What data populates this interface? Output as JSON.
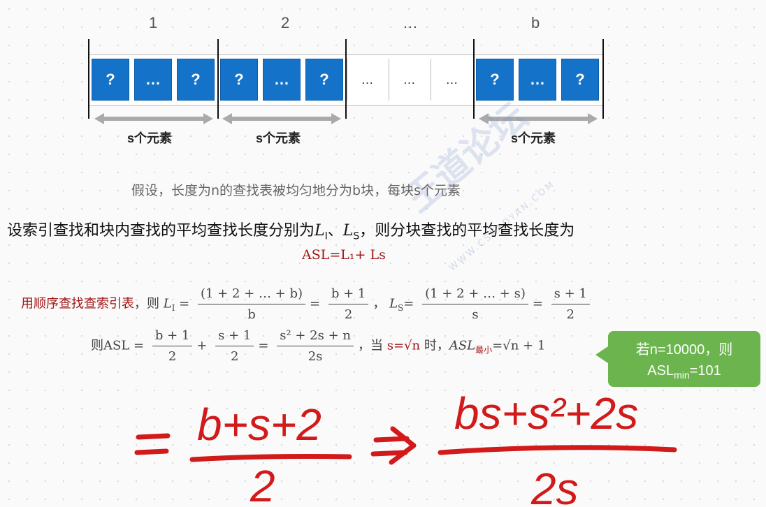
{
  "blocks": {
    "labels": [
      "1",
      "2",
      "…",
      "b"
    ],
    "cell_question": "?",
    "cell_dots": "…",
    "size_label": "s个元素"
  },
  "assumption": "假设，长度为n的查找表被均匀地分为b块，每块s个元素",
  "intro": {
    "text_before": "设索引查找和块内查找的平均查找长度分别为",
    "var_li": "L",
    "sub_i": "I",
    "sep": "、",
    "var_ls": "L",
    "sub_s": "S",
    "text_after": "，则分块查找的平均查找长度为"
  },
  "asl_formula": "ASL=L₁+ Ls",
  "formula1": {
    "prefix_plain": "用",
    "prefix_red": "顺序查找查索引表",
    "prefix_tail": "，则",
    "li_label": "L",
    "li_sub": "I",
    "eq": " =",
    "frac1_top": "(1 + 2 + … + b)",
    "frac1_bot": "b",
    "frac2_top": "b + 1",
    "frac2_bot": "2",
    "comma": "，",
    "ls_label": "L",
    "ls_sub": "S",
    "frac3_top": "(1 + 2 + … + s)",
    "frac3_bot": "s",
    "frac4_top": "s + 1",
    "frac4_bot": "2"
  },
  "formula2": {
    "prefix": "则ASL =",
    "a_top": "b + 1",
    "a_bot": "2",
    "plus": "+",
    "b_top": "s + 1",
    "b_bot": "2",
    "c_top": "s² + 2s + n",
    "c_bot": "2s",
    "when": "，当",
    "cond": "s=√n",
    "when2": "时，",
    "result_label": "ASL",
    "result_sub": "最小",
    "result_val": "=√n + 1"
  },
  "callout": {
    "line1": "若n=10000，则",
    "line2_main": "ASL",
    "line2_sub": "min",
    "line2_val": "=101"
  },
  "watermark": {
    "text": "王道论坛",
    "url": "WWW.CSKAOYAN.COM"
  },
  "handwriting": {
    "left_numerator": "b+s+2",
    "left_denominator": "2",
    "right_numerator": "bs+s²+2s",
    "right_denominator": "2s",
    "color": "#d21a1a"
  },
  "colors": {
    "cell_blue": "#1473c8",
    "accent_red": "#a31515",
    "callout_green": "#6bb44e"
  }
}
